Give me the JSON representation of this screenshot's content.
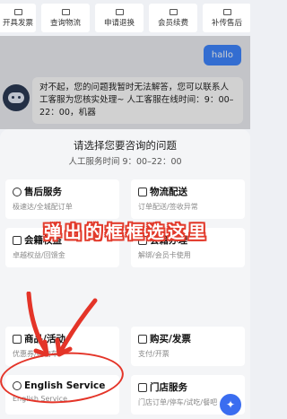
{
  "quick_bar": [
    {
      "label": "开具发票",
      "icon": "invoice-icon"
    },
    {
      "label": "查询物流",
      "icon": "logistics-icon"
    },
    {
      "label": "申请退换",
      "icon": "return-icon"
    },
    {
      "label": "会员续费",
      "icon": "member-icon"
    },
    {
      "label": "补传售后",
      "icon": "aftersale-icon"
    }
  ],
  "chat": {
    "user_message": "hallo",
    "bot_message": "对不起，您的问题我暂时无法解答，您可以联系人工客服为您核实处理~ 人工客服在线时间：9：00–22：00，机器"
  },
  "sheet": {
    "title": "请选择您要咨询的问题",
    "subtitle": "人工服务时间 9：00–22：00",
    "options": [
      {
        "title": "售后服务",
        "desc": "极速达/全城配订单",
        "icon": "aftersale-icon"
      },
      {
        "title": "物流配送",
        "desc": "订单配送/签收异常",
        "icon": "delivery-icon"
      },
      {
        "title": "会籍权益",
        "desc": "卓越权益/回馈金",
        "icon": "membership-icon"
      },
      {
        "title": "会籍办理",
        "desc": "解绑/会员卡使用",
        "icon": "membership-card-icon"
      },
      {
        "title": "商品/活动",
        "desc": "优惠券/购物车",
        "icon": "promotion-icon"
      },
      {
        "title": "购买/发票",
        "desc": "支付/开票",
        "icon": "invoice-icon"
      },
      {
        "title": "English Service",
        "desc": "English Service",
        "icon": "english-icon"
      },
      {
        "title": "门店服务",
        "desc": "门店订单/停车/试吃/餐吧",
        "icon": "store-icon"
      }
    ]
  },
  "annotation": {
    "banner_chars": [
      "弹",
      "出",
      "的",
      "框",
      "框",
      "选",
      "这",
      "里"
    ],
    "color": "#e23a2b"
  },
  "colors": {
    "accent": "#3f86ff",
    "annotation_red": "#e43428"
  }
}
